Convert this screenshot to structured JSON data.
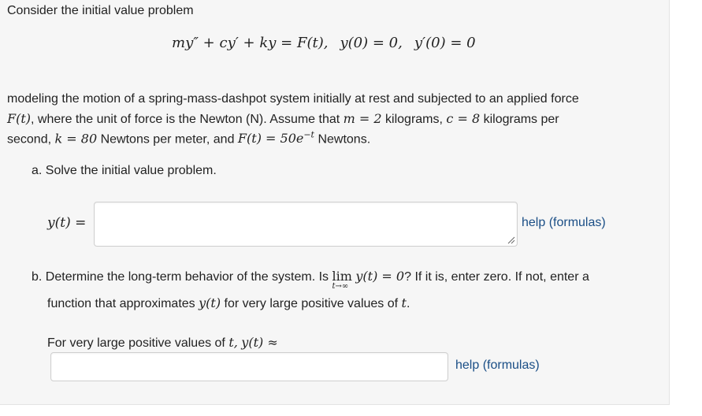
{
  "problem": {
    "intro": "Consider the initial value problem",
    "equation": {
      "lhs": "my″ + cy′ + ky = F(t),",
      "ic1": "y(0) = 0,",
      "ic2": "y′(0) = 0"
    },
    "description_line1": "modeling the motion of a spring-mass-dashpot system initially at rest and subjected to an applied force",
    "description_line2_ft": "F(t)",
    "description_line2_text": ", where the unit of force is the Newton (N). Assume that",
    "description_line2_m": "m = 2",
    "description_line2_kg": "kilograms,",
    "description_line2_c": "c = 8",
    "description_line2_kgper": "kilograms per",
    "description_line3_second": "second,",
    "description_line3_k": "k = 80",
    "description_line3_npm": "Newtons per meter, and",
    "description_line3_f": "F(t) = 50e",
    "description_line3_exp": "−t",
    "description_line3_newtons": "Newtons."
  },
  "part_a": {
    "prompt": "a. Solve the initial value problem.",
    "answer_label": "y(t) =",
    "answer_value": "",
    "help_link": "help (formulas)"
  },
  "part_b": {
    "prompt_start": "b. Determine the long-term behavior of the system. Is",
    "lim": "lim",
    "lim_sub": "t→∞",
    "lim_expr": "y(t) = 0",
    "prompt_end": "? If it is, enter zero. If not, enter a",
    "line2_start": "function that approximates",
    "line2_yt": "y(t)",
    "line2_mid": "for very large positive values of",
    "line2_t": "t",
    "line2_end": ".",
    "answer_label_start": "For very large positive values of",
    "answer_label_t": "t,",
    "answer_label_yt": "y(t) ≈",
    "answer_value": "",
    "help_link": "help (formulas)"
  }
}
